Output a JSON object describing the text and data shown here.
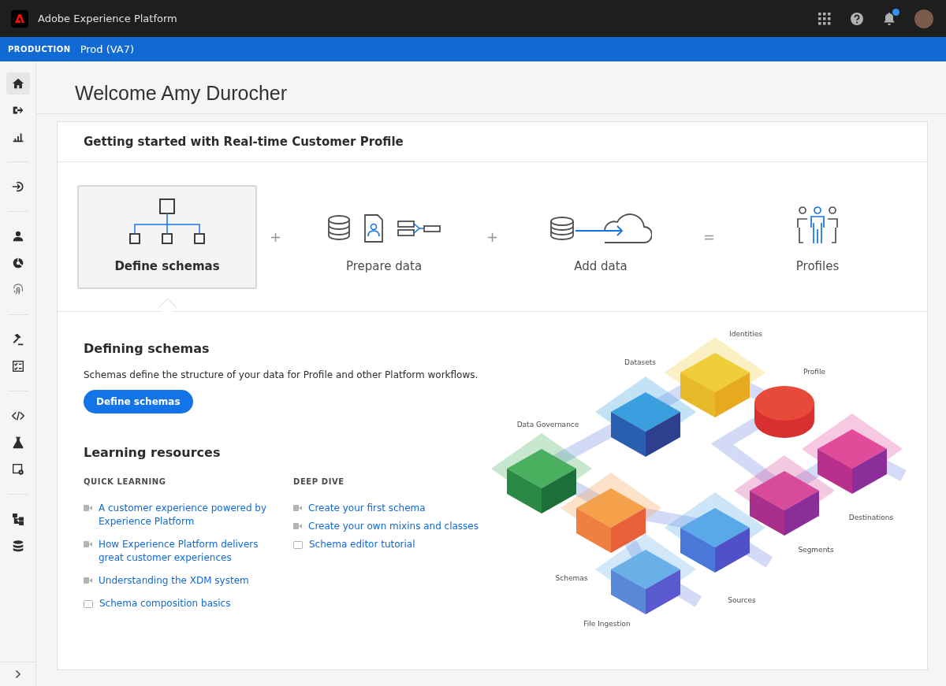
{
  "app_bar": {
    "title": "Adobe Experience Platform",
    "notifications_unread": true
  },
  "sandbox_bar": {
    "label": "PRODUCTION",
    "name": "Prod (VA7)"
  },
  "sidebar": {
    "groups": [
      [
        {
          "selected": true
        },
        {
          "selected": false
        },
        {
          "selected": false
        }
      ],
      [
        {
          "selected": false
        }
      ],
      [
        {
          "selected": false
        },
        {
          "selected": false
        },
        {
          "selected": false
        }
      ],
      [
        {
          "selected": false
        },
        {
          "selected": false
        }
      ],
      [
        {
          "selected": false
        },
        {
          "selected": false
        },
        {
          "selected": false
        }
      ],
      [
        {
          "selected": false
        },
        {
          "selected": false
        }
      ]
    ]
  },
  "page_title": "Welcome Amy Durocher",
  "card": {
    "title": "Getting started with Real-time Customer Profile",
    "steps": [
      {
        "label": "Define schemas",
        "selected": true
      },
      {
        "label": "Prepare data",
        "selected": false
      },
      {
        "label": "Add data",
        "selected": false
      },
      {
        "label": "Profiles",
        "selected": false
      }
    ],
    "operators": [
      "+",
      "+",
      "="
    ],
    "detail": {
      "heading": "Defining schemas",
      "description": "Schemas define the structure of your data for Profile and other Platform workflows.",
      "button": "Define schemas"
    },
    "learning": {
      "heading": "Learning resources",
      "columns": [
        {
          "title": "QUICK LEARNING",
          "links": [
            {
              "kind": "video",
              "text": "A customer experience powered by Experience Platform"
            },
            {
              "kind": "video",
              "text": "How Experience Platform delivers great customer experiences"
            },
            {
              "kind": "video",
              "text": "Understanding the XDM system"
            },
            {
              "kind": "doc",
              "text": "Schema composition basics"
            }
          ]
        },
        {
          "title": "DEEP DIVE",
          "links": [
            {
              "kind": "video",
              "text": "Create your first schema"
            },
            {
              "kind": "video",
              "text": "Create your own mixins and classes"
            },
            {
              "kind": "doc",
              "text": "Schema editor tutorial"
            }
          ]
        }
      ]
    },
    "diagram": {
      "labels": [
        "Identities",
        "Datasets",
        "Profile",
        "Data Governance",
        "Destinations",
        "Segments",
        "Schemas",
        "Sources",
        "File Ingestion"
      ]
    }
  }
}
